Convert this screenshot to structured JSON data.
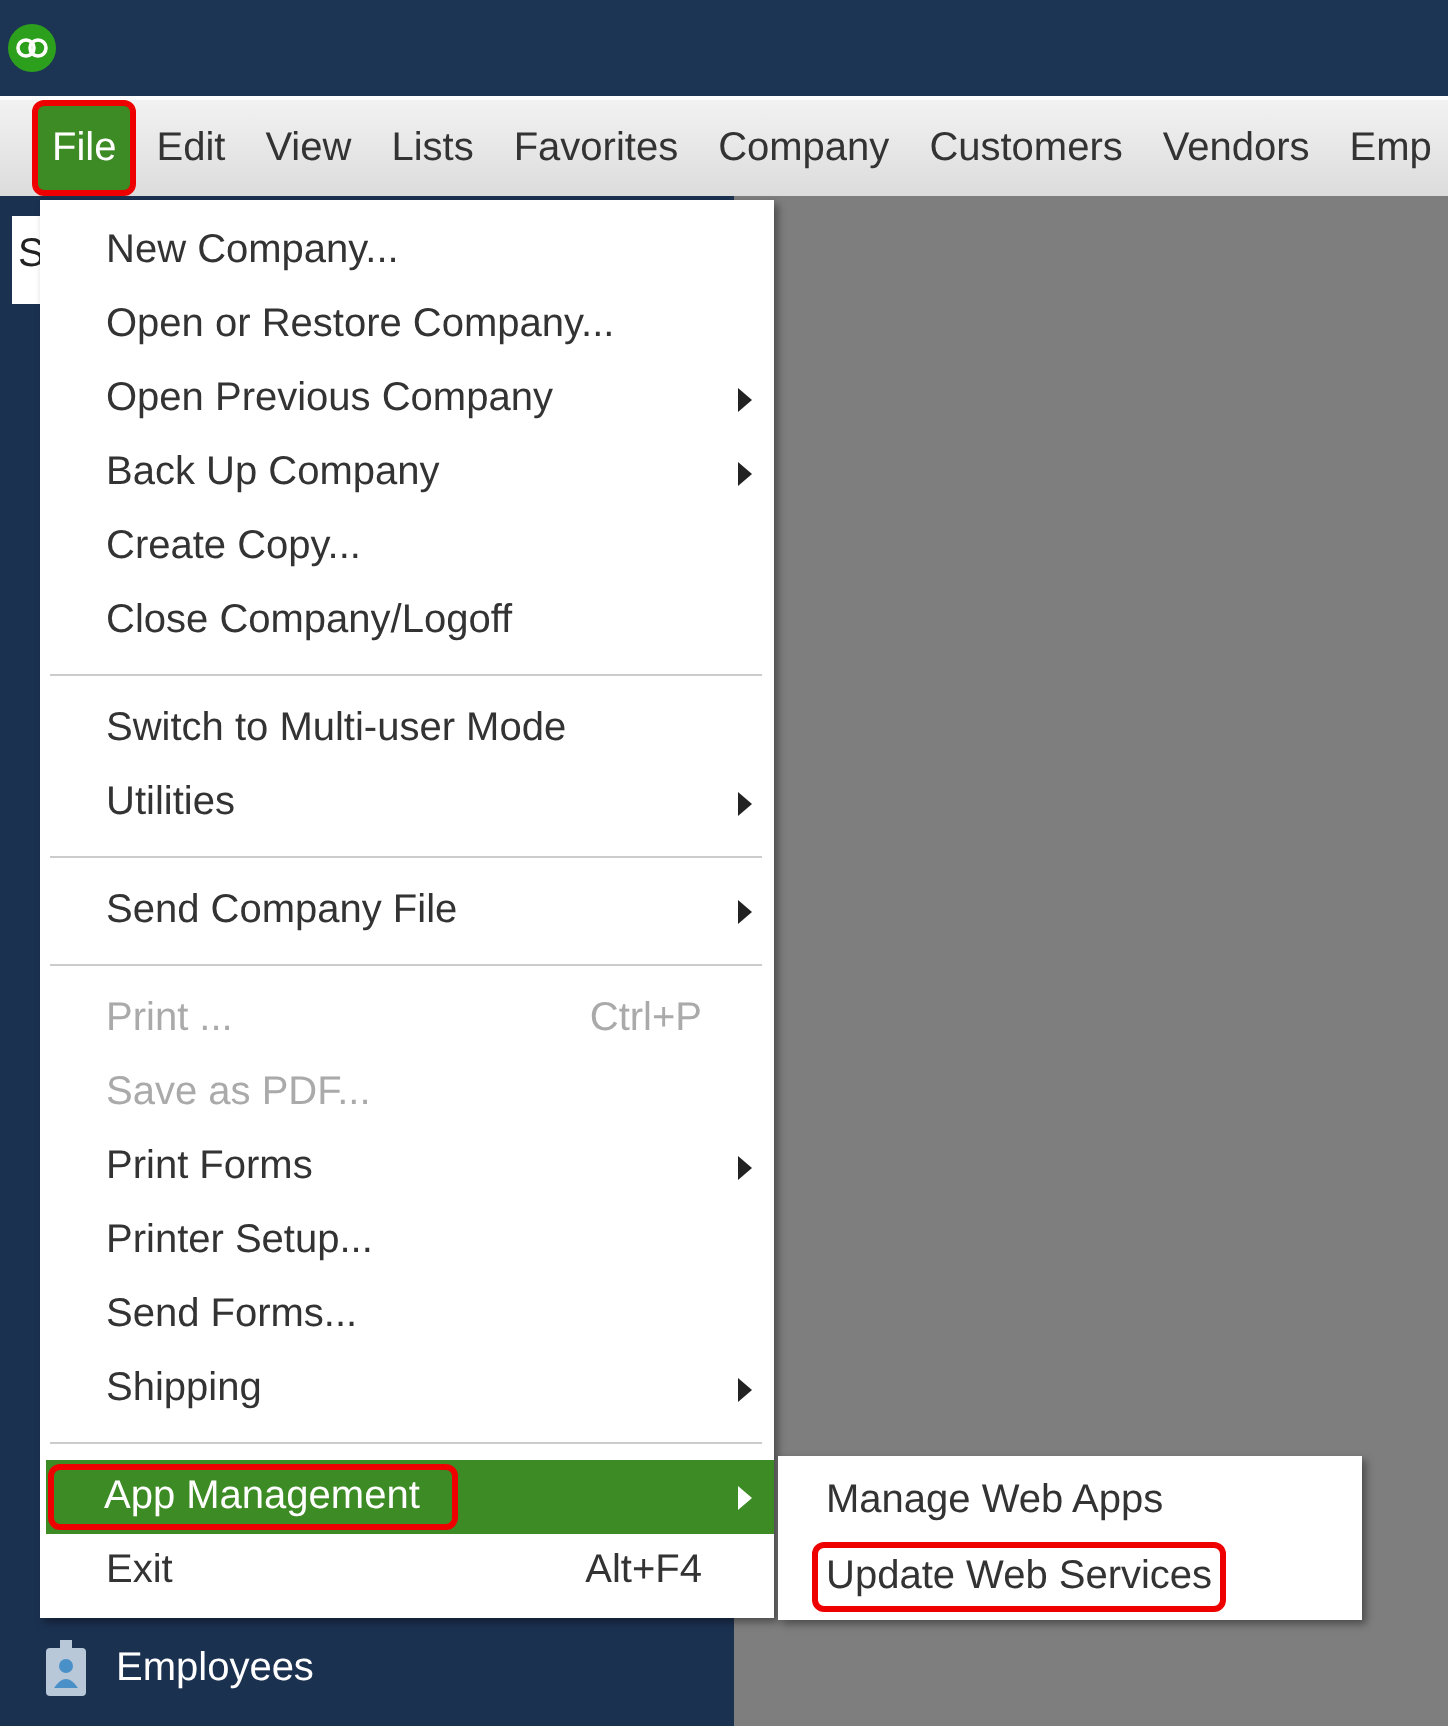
{
  "menubar": [
    {
      "label": "File",
      "selected": true,
      "highlighted": true
    },
    {
      "label": "Edit",
      "selected": false,
      "highlighted": false
    },
    {
      "label": "View",
      "selected": false,
      "highlighted": false
    },
    {
      "label": "Lists",
      "selected": false,
      "highlighted": false
    },
    {
      "label": "Favorites",
      "selected": false,
      "highlighted": false
    },
    {
      "label": "Company",
      "selected": false,
      "highlighted": false
    },
    {
      "label": "Customers",
      "selected": false,
      "highlighted": false
    },
    {
      "label": "Vendors",
      "selected": false,
      "highlighted": false
    },
    {
      "label": "Emp",
      "selected": false,
      "highlighted": false
    }
  ],
  "sidebar": {
    "search": {
      "value": "S"
    },
    "items": [
      {
        "label": "Employees"
      }
    ]
  },
  "file_menu": [
    {
      "kind": "item",
      "label": "New Company...",
      "submenu": false,
      "disabled": false,
      "selected": false,
      "highlighted": false
    },
    {
      "kind": "item",
      "label": "Open or Restore Company...",
      "submenu": false,
      "disabled": false,
      "selected": false,
      "highlighted": false
    },
    {
      "kind": "item",
      "label": "Open Previous Company",
      "submenu": true,
      "disabled": false,
      "selected": false,
      "highlighted": false
    },
    {
      "kind": "item",
      "label": "Back Up Company",
      "submenu": true,
      "disabled": false,
      "selected": false,
      "highlighted": false
    },
    {
      "kind": "item",
      "label": "Create Copy...",
      "submenu": false,
      "disabled": false,
      "selected": false,
      "highlighted": false
    },
    {
      "kind": "item",
      "label": "Close Company/Logoff",
      "submenu": false,
      "disabled": false,
      "selected": false,
      "highlighted": false
    },
    {
      "kind": "separator"
    },
    {
      "kind": "item",
      "label": "Switch to Multi-user Mode",
      "submenu": false,
      "disabled": false,
      "selected": false,
      "highlighted": false
    },
    {
      "kind": "item",
      "label": "Utilities",
      "submenu": true,
      "disabled": false,
      "selected": false,
      "highlighted": false
    },
    {
      "kind": "separator"
    },
    {
      "kind": "item",
      "label": "Send Company File",
      "submenu": true,
      "disabled": false,
      "selected": false,
      "highlighted": false
    },
    {
      "kind": "separator"
    },
    {
      "kind": "item",
      "label": "Print ...",
      "shortcut": "Ctrl+P",
      "submenu": false,
      "disabled": true,
      "selected": false,
      "highlighted": false
    },
    {
      "kind": "item",
      "label": "Save as PDF...",
      "submenu": false,
      "disabled": true,
      "selected": false,
      "highlighted": false
    },
    {
      "kind": "item",
      "label": "Print Forms",
      "submenu": true,
      "disabled": false,
      "selected": false,
      "highlighted": false
    },
    {
      "kind": "item",
      "label": "Printer Setup...",
      "submenu": false,
      "disabled": false,
      "selected": false,
      "highlighted": false
    },
    {
      "kind": "item",
      "label": "Send Forms...",
      "submenu": false,
      "disabled": false,
      "selected": false,
      "highlighted": false
    },
    {
      "kind": "item",
      "label": "Shipping",
      "submenu": true,
      "disabled": false,
      "selected": false,
      "highlighted": false
    },
    {
      "kind": "separator"
    },
    {
      "kind": "item",
      "label": "App Management",
      "submenu": true,
      "disabled": false,
      "selected": true,
      "highlighted": true
    },
    {
      "kind": "item",
      "label": "Exit",
      "shortcut": "Alt+F4",
      "submenu": false,
      "disabled": false,
      "selected": false,
      "highlighted": false
    }
  ],
  "submenu": [
    {
      "label": "Manage Web Apps",
      "highlighted": false
    },
    {
      "label": "Update Web Services",
      "highlighted": true
    }
  ]
}
